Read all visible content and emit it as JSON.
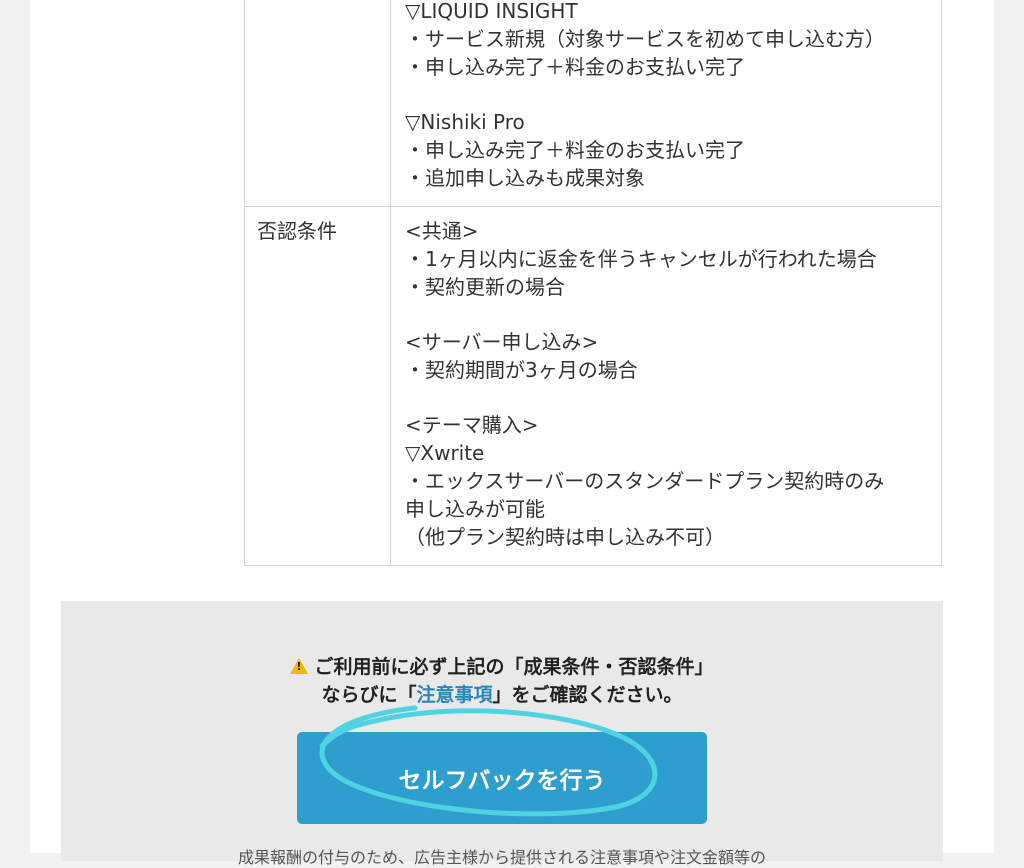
{
  "conditions": {
    "approval_lines": [
      "▽LIQUID INSIGHT",
      "・サービス新規（対象サービスを初めて申し込む方）",
      "・申し込み完了＋料金のお支払い完了",
      "",
      "▽Nishiki Pro",
      "・申し込み完了＋料金のお支払い完了",
      "・追加申し込みも成果対象"
    ],
    "rejection_label": "否認条件",
    "rejection_lines": [
      "<共通>",
      "・1ヶ月以内に返金を伴うキャンセルが行われた場合",
      "・契約更新の場合",
      "",
      "<サーバー申し込み>",
      "・契約期間が3ヶ月の場合",
      "",
      "<テーマ購入>",
      "▽Xwrite",
      "・エックスサーバーのスタンダードプラン契約時のみ",
      "申し込みが可能",
      "（他プラン契約時は申し込み不可）"
    ]
  },
  "cta": {
    "notice_line1": "ご利用前に必ず上記の「成果条件・否認条件」",
    "notice_line2_pre": "ならびに「",
    "notice_link": "注意事項",
    "notice_line2_post": "」をご確認ください。",
    "button_label": "セルフバックを行う",
    "bottom_text": "成果報酬の付与のため、広告主様から提供される注意事項や注文金額等の",
    "annotation_color": "#4fd3e3"
  }
}
